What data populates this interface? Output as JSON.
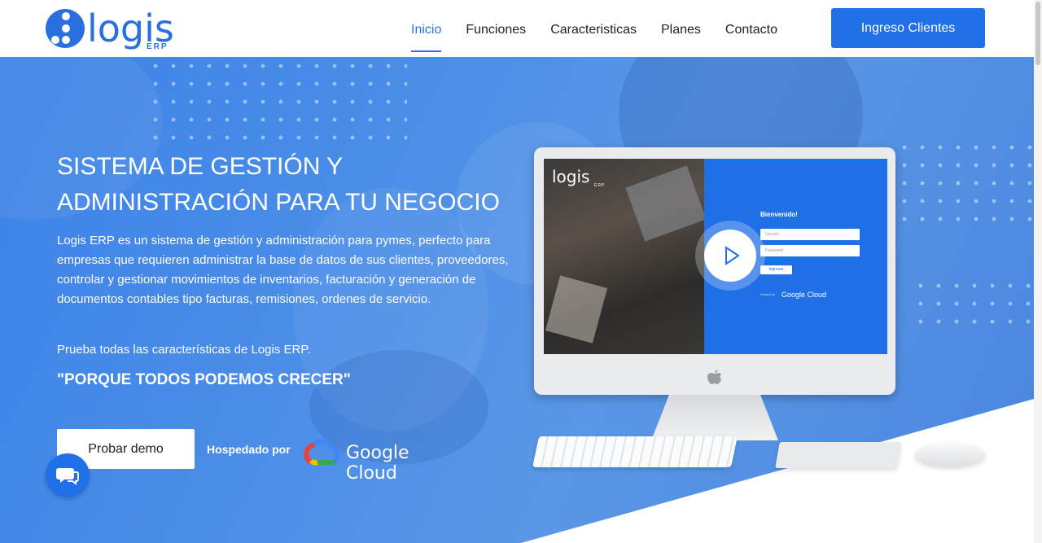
{
  "brand": {
    "name": "logis",
    "sub": "ERP"
  },
  "nav": {
    "items": [
      {
        "label": "Inicio",
        "active": true
      },
      {
        "label": "Funciones",
        "active": false
      },
      {
        "label": "Caracteristicas",
        "active": false
      },
      {
        "label": "Planes",
        "active": false
      },
      {
        "label": "Contacto",
        "active": false
      }
    ],
    "login_button": "Ingreso Clientes"
  },
  "hero": {
    "title_line1": "SISTEMA DE GESTIÓN Y",
    "title_line2": "ADMINISTRACIÓN PARA TU NEGOCIO",
    "description": "Logis ERP es un sistema de gestión y administración para pymes, perfecto para empresas que requieren administrar la base de datos de sus clientes, proveedores, controlar y gestionar movimientos de inventarios, facturación y generación de documentos contables tipo facturas, remisiones, ordenes de servicio.",
    "try_text": "Prueba todas las características de Logis ERP.",
    "slogan": "\"PORQUE TODOS PODEMOS CRECER\"",
    "demo_button": "Probar demo",
    "hosted_by": "Hospedado por",
    "cloud_name": "Google Cloud"
  },
  "screen": {
    "logo": "logis",
    "logo_sub": "ERP",
    "welcome": "Bienvenido!",
    "user_placeholder": "Usuario",
    "password_placeholder": "Password",
    "login_button": "Ingresar",
    "hosted": "Hosted by",
    "cloud": "Google Cloud"
  },
  "colors": {
    "accent": "#2170e8",
    "hero_blue": "#4a8ae6"
  },
  "icons": {
    "chat": "chat-bubble-icon",
    "play": "play-icon",
    "apple": "apple-logo-icon"
  }
}
